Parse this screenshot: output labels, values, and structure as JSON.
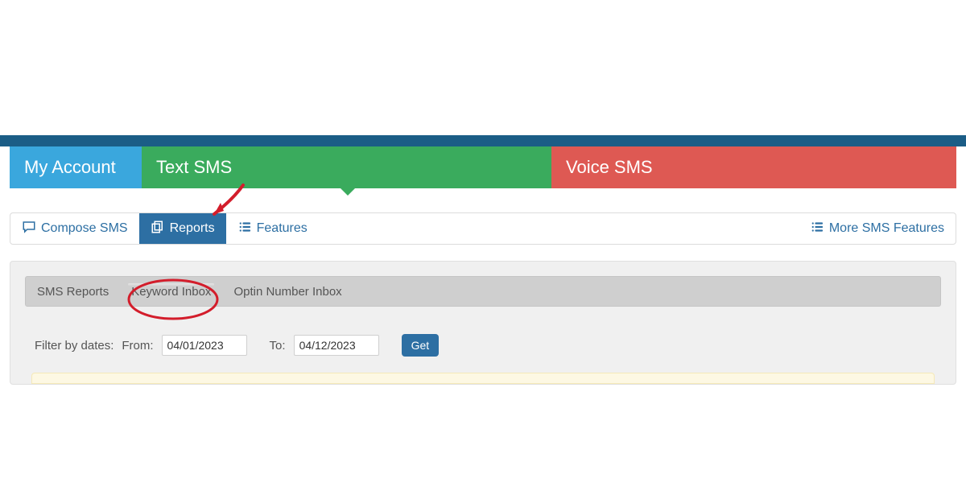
{
  "mainTabs": {
    "myAccount": "My Account",
    "textSms": "Text SMS",
    "voiceSms": "Voice SMS"
  },
  "subBar": {
    "compose": "Compose SMS",
    "reports": "Reports",
    "features": "Features",
    "moreFeatures": "More SMS Features"
  },
  "innerTabs": {
    "smsReports": "SMS Reports",
    "keywordInbox": "Keyword Inbox",
    "optinInbox": "Optin Number Inbox"
  },
  "filter": {
    "label": "Filter by dates:",
    "fromLabel": "From:",
    "fromValue": "04/01/2023",
    "toLabel": "To:",
    "toValue": "04/12/2023",
    "getLabel": "Get"
  }
}
